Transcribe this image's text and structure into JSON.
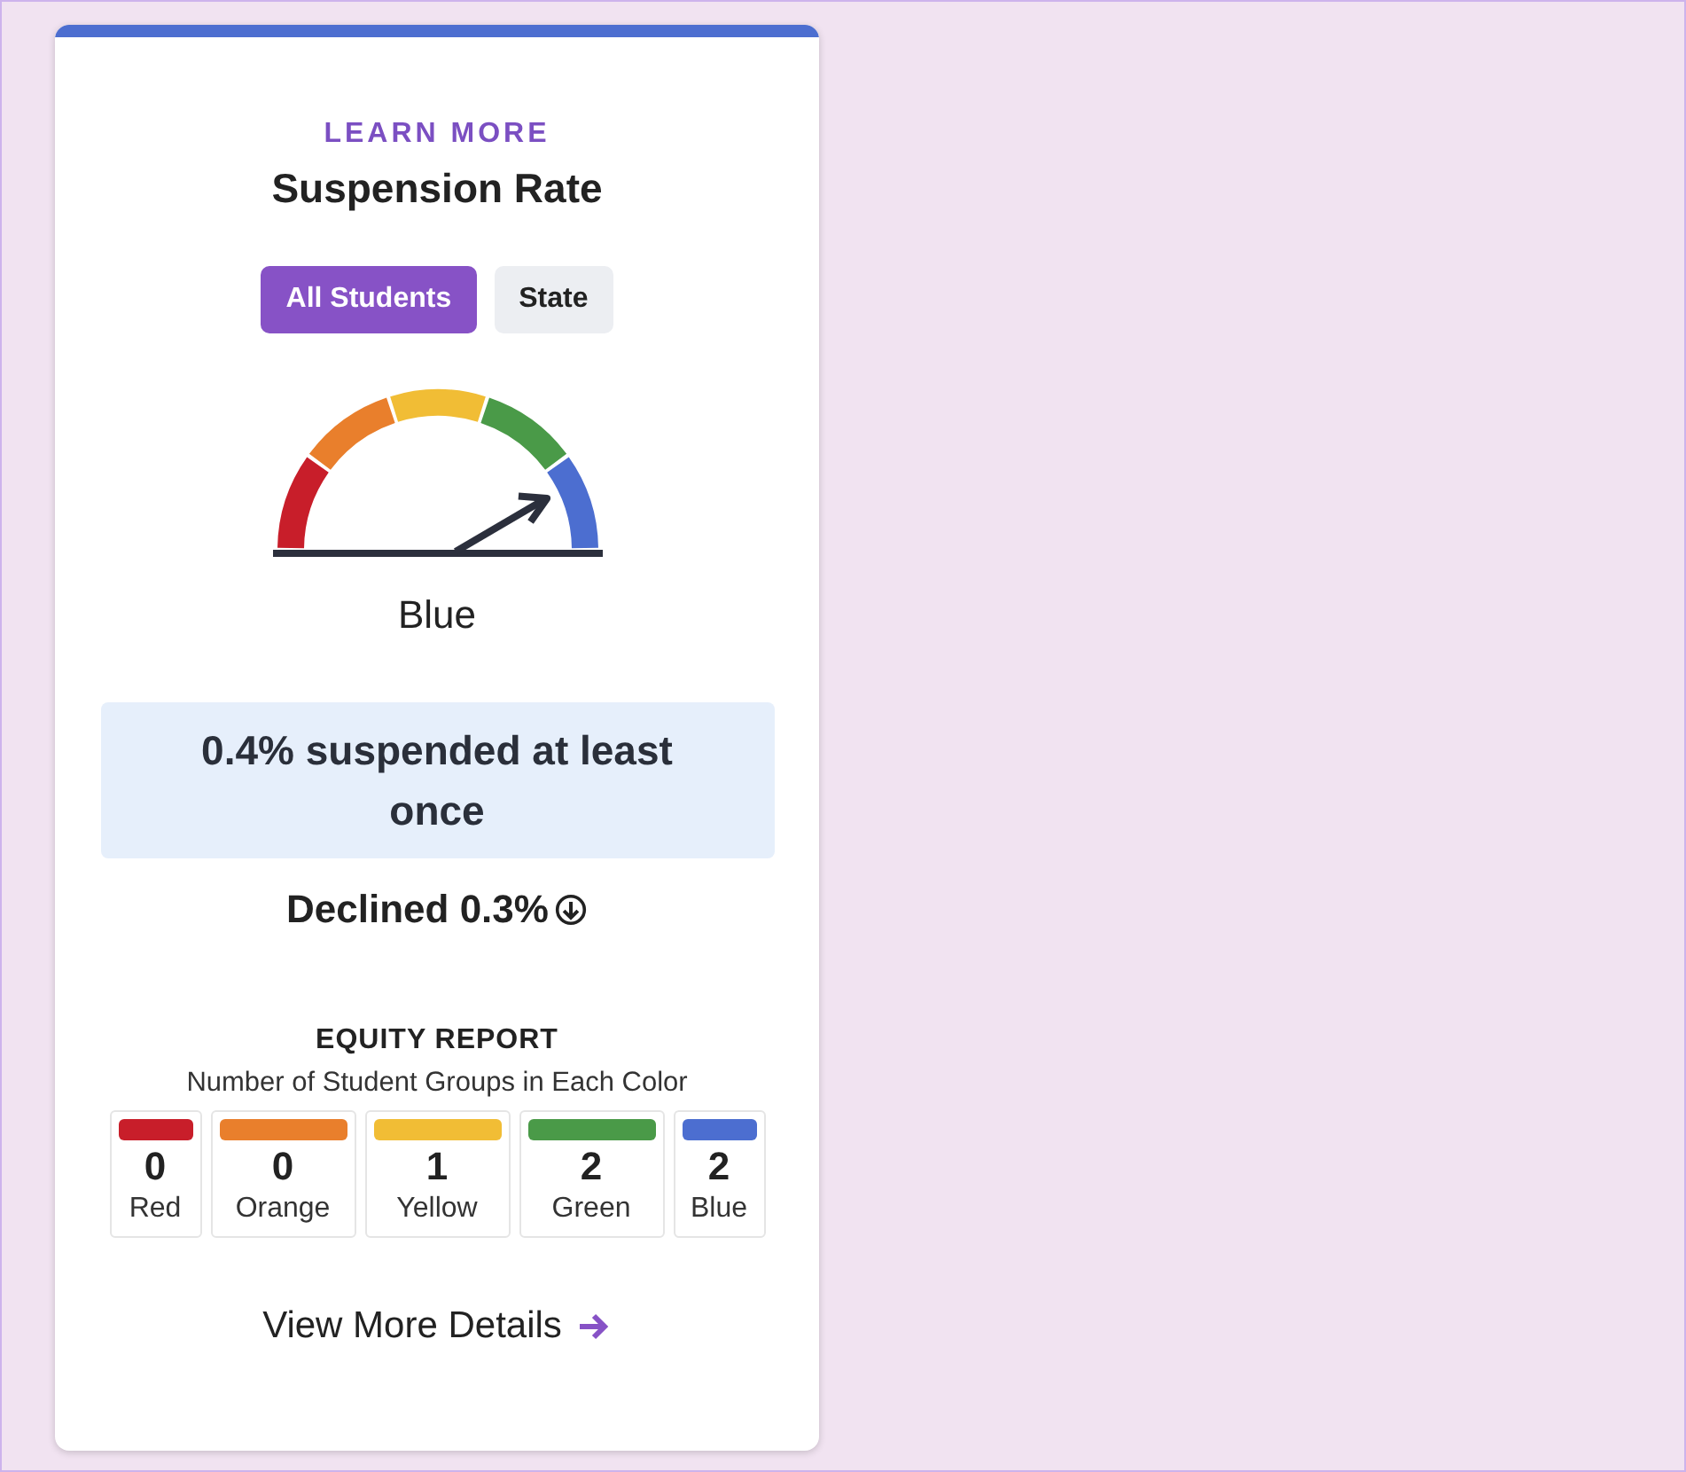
{
  "card": {
    "link": "LEARN MORE",
    "title": "Suspension Rate",
    "tabs": [
      {
        "label": "All Students",
        "selected": true
      },
      {
        "label": "State",
        "selected": false
      }
    ],
    "gauge": {
      "segments": [
        {
          "color": "#c81e2a"
        },
        {
          "color": "#e97f2c"
        },
        {
          "color": "#f1bd35"
        },
        {
          "color": "#4a9a48"
        },
        {
          "color": "#4c6ed0"
        }
      ]
    },
    "status": "Blue",
    "summary": "0.4% suspended at least once",
    "change": "Declined 0.3%",
    "equity": {
      "heading": "EQUITY REPORT",
      "subheading": "Number of Student Groups in Each Color",
      "groups": [
        {
          "count": "0",
          "label": "Red",
          "color": "#c81e2a"
        },
        {
          "count": "0",
          "label": "Orange",
          "color": "#e97f2c"
        },
        {
          "count": "1",
          "label": "Yellow",
          "color": "#f1bd35"
        },
        {
          "count": "2",
          "label": "Green",
          "color": "#4a9a48"
        },
        {
          "count": "2",
          "label": "Blue",
          "color": "#4c6ed0"
        }
      ]
    },
    "details_link": "View More Details"
  }
}
